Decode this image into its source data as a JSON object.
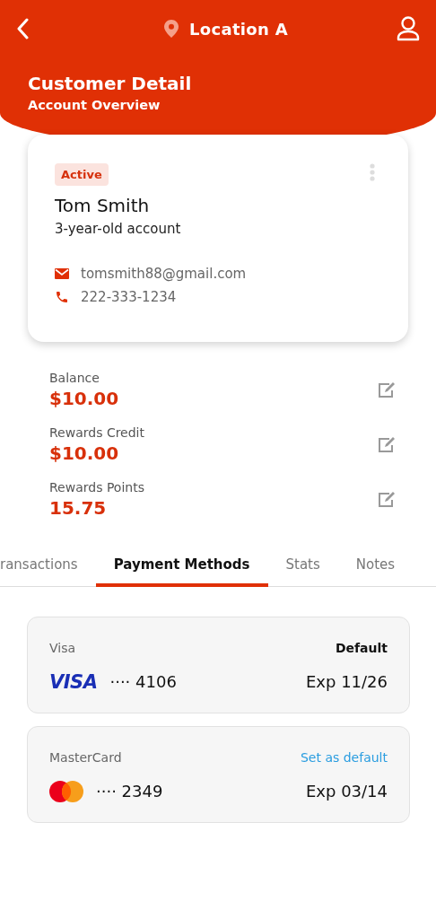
{
  "top_bar": {
    "location": "Location A"
  },
  "header": {
    "title": "Customer Detail",
    "subtitle": "Account Overview"
  },
  "customer": {
    "status": "Active",
    "name": "Tom Smith",
    "account_age": "3-year-old account",
    "email": "tomsmith88@gmail.com",
    "phone": "222-333-1234"
  },
  "stats": [
    {
      "label": "Balance",
      "value": "$10.00"
    },
    {
      "label": "Rewards Credit",
      "value": "$10.00"
    },
    {
      "label": "Rewards Points",
      "value": "15.75"
    }
  ],
  "tabs": [
    {
      "label": "ransactions",
      "selected": false
    },
    {
      "label": "Payment Methods",
      "selected": true
    },
    {
      "label": "Stats",
      "selected": false
    },
    {
      "label": "Notes",
      "selected": false
    }
  ],
  "payment_methods": [
    {
      "kind": "visa",
      "name": "Visa",
      "default": true,
      "status": "Default",
      "brand_mark": "VISA",
      "number": "···· 4106",
      "expiry": "Exp 11/26"
    },
    {
      "kind": "mastercard",
      "name": "MasterCard",
      "default": false,
      "status": "Set as default",
      "number": "···· 2349",
      "expiry": "Exp 03/14"
    }
  ]
}
